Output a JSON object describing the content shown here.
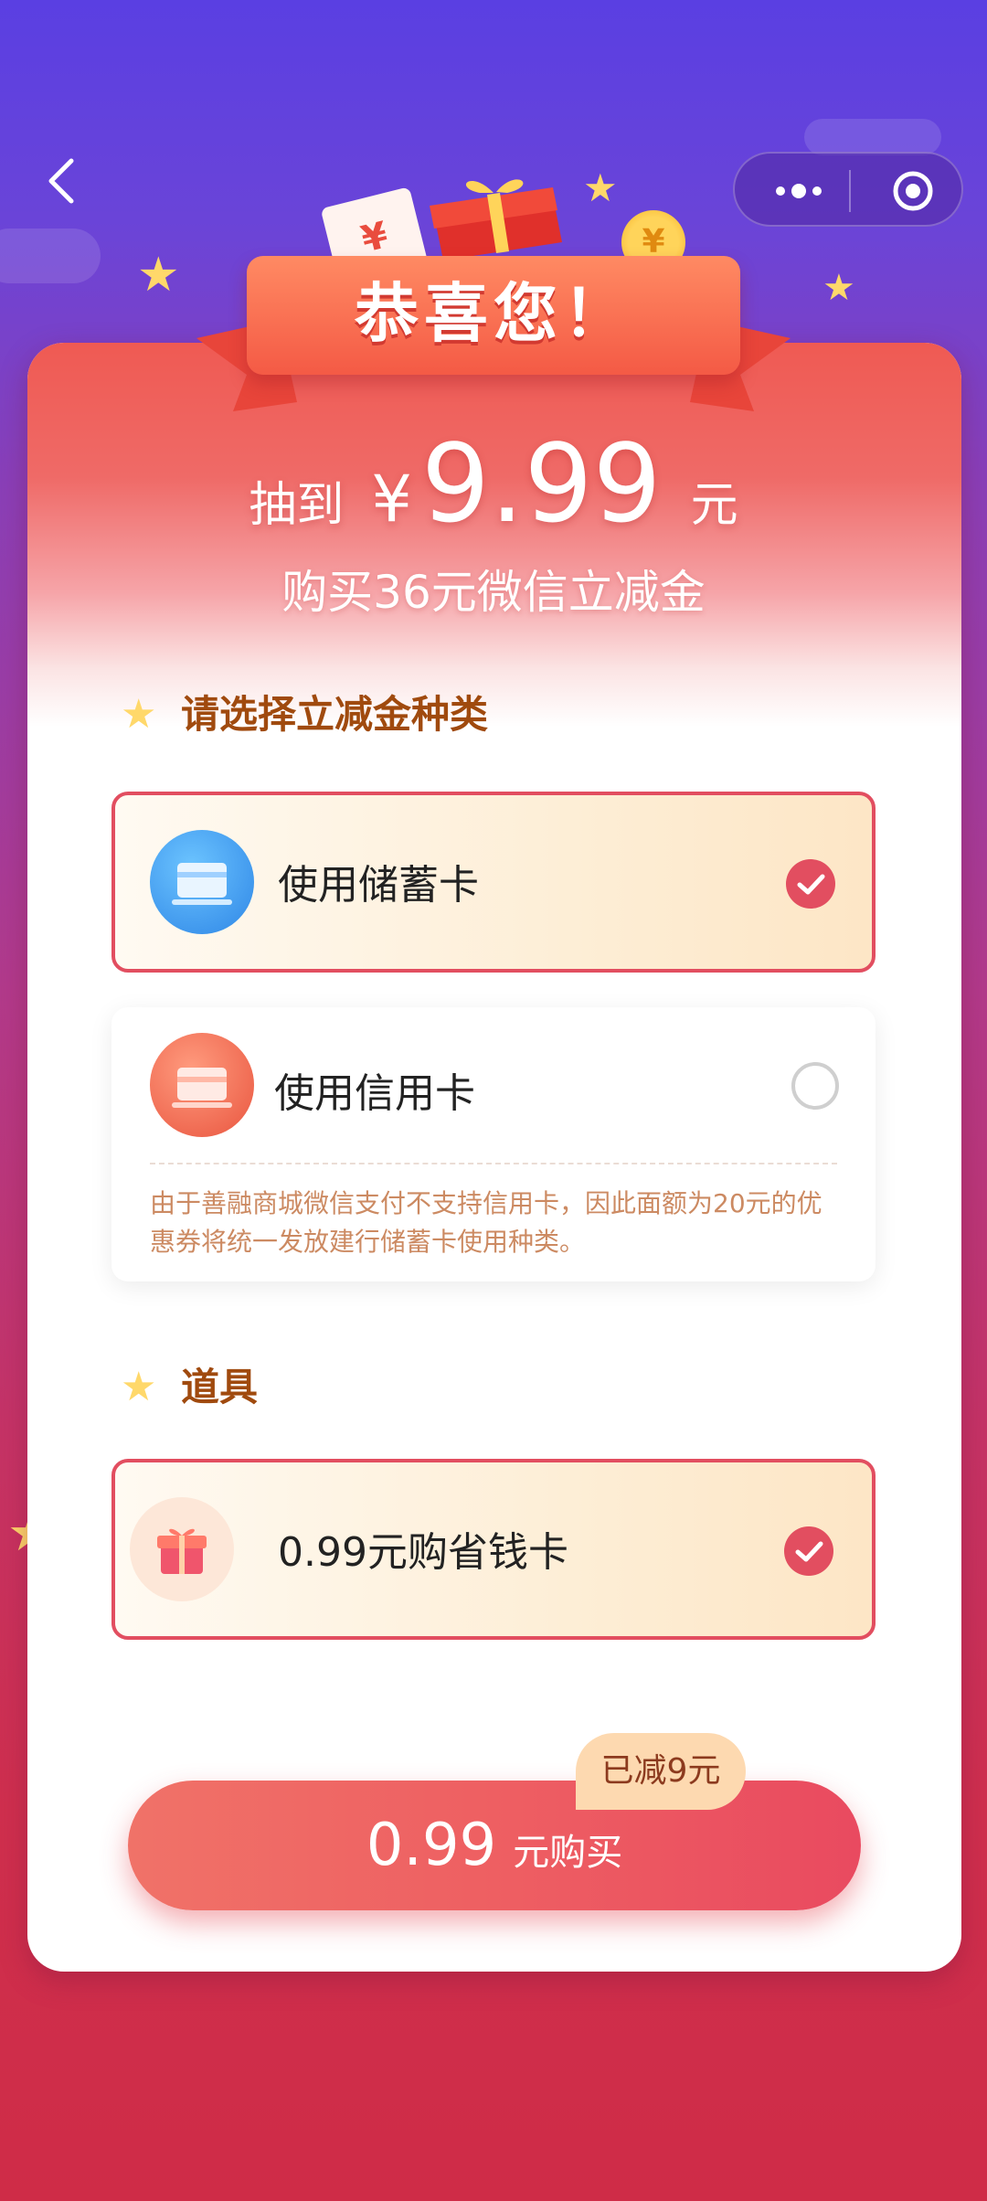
{
  "banner": {
    "title": "恭喜您！"
  },
  "prize": {
    "prefix": "抽到",
    "currency": "¥",
    "amount": "9.99",
    "unit": "元",
    "subtitle": "购买36元微信立减金"
  },
  "section_type": {
    "title": "请选择立减金种类"
  },
  "options": [
    {
      "label": "使用储蓄卡",
      "selected": true,
      "icon": "debit-card-icon"
    },
    {
      "label": "使用信用卡",
      "selected": false,
      "icon": "credit-card-icon",
      "note": "由于善融商城微信支付不支持信用卡，因此面额为20元的优惠券将统一发放建行储蓄卡使用种类。"
    }
  ],
  "section_props": {
    "title": "道具"
  },
  "prop_item": {
    "label": "0.99元购省钱卡",
    "selected": true,
    "icon": "gift-icon"
  },
  "purchase": {
    "amount": "0.99",
    "suffix": "元购买",
    "saved_badge": "已减9元"
  },
  "colors": {
    "accent": "#e24e60",
    "section_title": "#a04a0e",
    "bg_top": "#5a3fe2",
    "bg_bottom": "#cf2c47"
  }
}
